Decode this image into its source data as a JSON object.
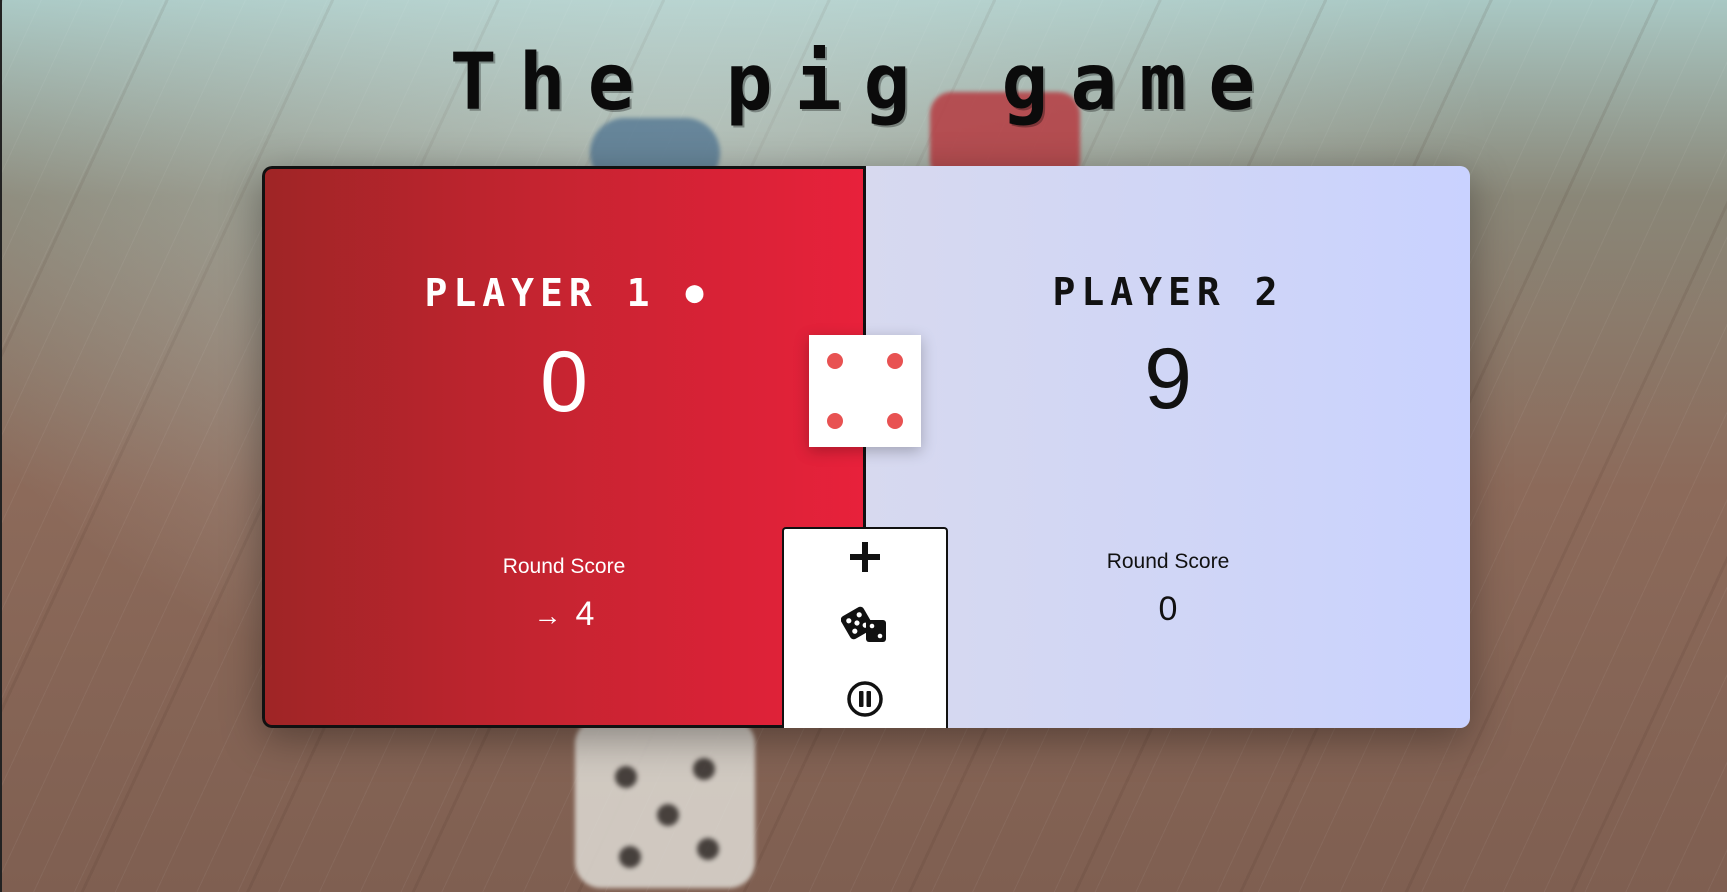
{
  "title": "The pig game",
  "players": [
    {
      "name": "PLAYER 1",
      "score": "0",
      "round_label": "Round Score",
      "round_value": "4",
      "active": true
    },
    {
      "name": "PLAYER 2",
      "score": "9",
      "round_label": "Round Score",
      "round_value": "0",
      "active": false
    }
  ],
  "active_marker": "●",
  "round_arrow": "→",
  "dice": {
    "value": 4,
    "pip_color": "#e85252"
  },
  "controls": {
    "new_game_icon": "plus-icon",
    "roll_icon": "dice-icon",
    "hold_icon": "pause-circle-icon"
  },
  "colors": {
    "player1_accent": "#e8213b",
    "player2_bg": "#cfd5f7"
  }
}
